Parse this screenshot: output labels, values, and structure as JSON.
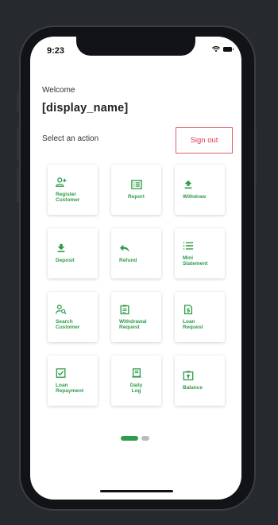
{
  "status_bar": {
    "time": "9:23"
  },
  "header": {
    "welcome": "Welcome",
    "display_name": "[display_name]",
    "select_action": "Select an action",
    "sign_out": "Sign out"
  },
  "actions": [
    {
      "label": "Register\nCustomer",
      "icon": "add-person-icon"
    },
    {
      "label": "Report",
      "icon": "report-list-icon"
    },
    {
      "label": "Withdraw",
      "icon": "upload-icon"
    },
    {
      "label": "Deposit",
      "icon": "download-icon"
    },
    {
      "label": "Refund",
      "icon": "reply-icon"
    },
    {
      "label": "Mini\nStatement",
      "icon": "list-icon"
    },
    {
      "label": "Search\nCustomer",
      "icon": "person-search-icon"
    },
    {
      "label": "Withdrawal\nRequest",
      "icon": "clipboard-icon"
    },
    {
      "label": "Loan\nRequest",
      "icon": "money-doc-icon"
    },
    {
      "label": "Loan\nRepayment",
      "icon": "checkbox-icon"
    },
    {
      "label": "Daily\nLog",
      "icon": "log-icon"
    },
    {
      "label": "Balance",
      "icon": "balance-icon"
    }
  ],
  "colors": {
    "accent": "#2e9c48",
    "signout": "#d93a4a",
    "background": "#26292d"
  },
  "pagination": {
    "pages": 2,
    "active": 1
  }
}
